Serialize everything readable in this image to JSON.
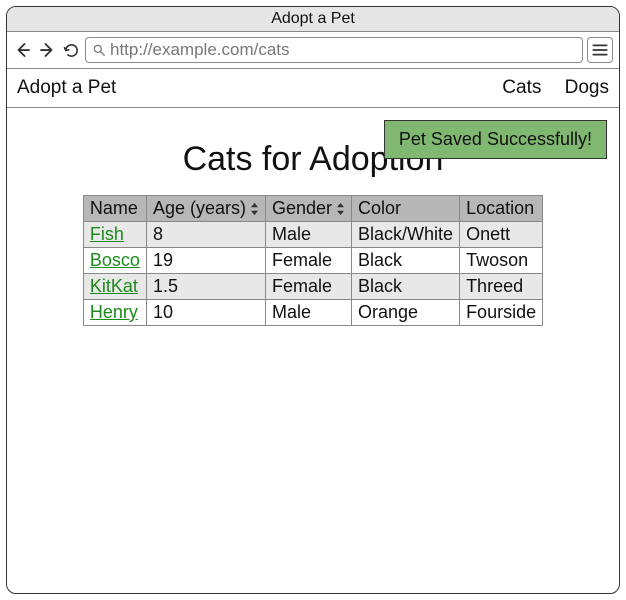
{
  "window": {
    "title": "Adopt a Pet"
  },
  "browser": {
    "url": "http://example.com/cats"
  },
  "nav": {
    "brand": "Adopt a Pet",
    "links": [
      "Cats",
      "Dogs"
    ]
  },
  "toast": {
    "message": "Pet Saved Successfully!"
  },
  "page": {
    "heading": "Cats for Adoption"
  },
  "table": {
    "columns": [
      {
        "label": "Name",
        "sortable": false
      },
      {
        "label": "Age (years)",
        "sortable": true
      },
      {
        "label": "Gender",
        "sortable": true
      },
      {
        "label": "Color",
        "sortable": false
      },
      {
        "label": "Location",
        "sortable": false
      }
    ],
    "rows": [
      {
        "name": "Fish",
        "age": "8",
        "gender": "Male",
        "color": "Black/White",
        "location": "Onett"
      },
      {
        "name": "Bosco",
        "age": "19",
        "gender": "Female",
        "color": "Black",
        "location": "Twoson"
      },
      {
        "name": "KitKat",
        "age": "1.5",
        "gender": "Female",
        "color": "Black",
        "location": "Threed"
      },
      {
        "name": "Henry",
        "age": "10",
        "gender": "Male",
        "color": "Orange",
        "location": "Fourside"
      }
    ]
  }
}
